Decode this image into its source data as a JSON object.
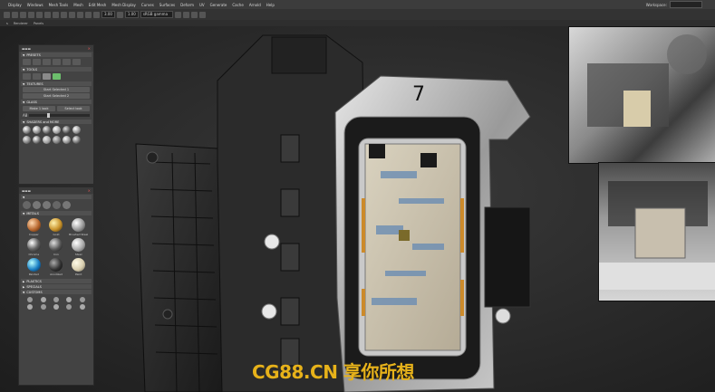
{
  "menubar": {
    "items": [
      "",
      "Display",
      "Windows",
      "Mesh Tools",
      "Mesh",
      "Edit Mesh",
      "Mesh Display",
      "Curves",
      "Surfaces",
      "Deform",
      "UV",
      "Generate",
      "Cache",
      "Arnold",
      "Help"
    ],
    "workspace_label": "Workspace:"
  },
  "toolbar": {
    "field1": "3.00",
    "field2": "1.00",
    "field3": "sRGB gamma"
  },
  "subbar": {
    "items": [
      "s",
      "Renderer",
      "Panels"
    ]
  },
  "panel_top": {
    "sections": {
      "presets": "PRESETS",
      "tools": "TOOLS",
      "textures": "TEXTURES",
      "glass": "GLASS",
      "shaders": "SHADERS and MORE"
    },
    "btn1": "Start Selected 1",
    "btn2": "Start Selected 2",
    "glass_btn1": "Make 1 look",
    "glass_btn2": "Select look",
    "range_value": "A8"
  },
  "panel_bottom": {
    "sections": {
      "metals": "METALS",
      "plastics": "PLASTICS",
      "specials": "SPECIALS",
      "customs": "CUSTOMS"
    },
    "materials": [
      "Copper",
      "Gold",
      "Brushed Steel",
      "Chrome",
      "Iron",
      "Steel",
      "Painted",
      "Anodized",
      "Paint"
    ]
  },
  "watermark": "CG88.CN 享你所想",
  "colors": {
    "watermark": "#e7b21a",
    "close": "#d55555"
  }
}
